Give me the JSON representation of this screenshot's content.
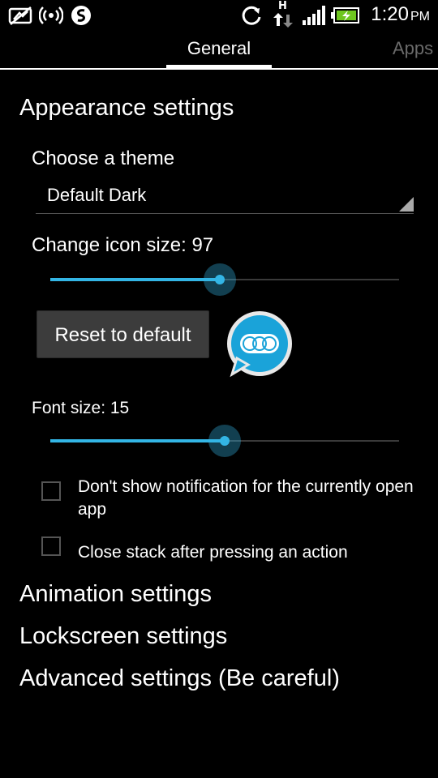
{
  "status_bar": {
    "time": "1:20",
    "ampm": "PM",
    "icons": [
      "no-sim-icon",
      "wireless-icon",
      "swiftkey-icon",
      "sync-icon",
      "data-transfer-icon",
      "signal-icon",
      "battery-charging-icon"
    ],
    "network_type": "H"
  },
  "tabs": [
    {
      "label": "General",
      "selected": true
    },
    {
      "label": "Apps",
      "selected": false
    }
  ],
  "sections": {
    "appearance": "Appearance settings",
    "animation": "Animation settings",
    "lockscreen": "Lockscreen settings",
    "advanced": "Advanced settings (Be careful)"
  },
  "theme": {
    "label": "Choose a theme",
    "value": "Default Dark"
  },
  "icon_size": {
    "label": "Change icon size: 97",
    "value": 97,
    "fraction": 0.485
  },
  "reset_button": "Reset to default",
  "font_size": {
    "label": "Font size: 15",
    "value": 15,
    "fraction": 0.5
  },
  "checkboxes": [
    {
      "label": "Don't show notification for the currently open app",
      "checked": false
    },
    {
      "label": "Close stack after pressing an action",
      "checked": false
    }
  ],
  "colors": {
    "accent": "#33b5e5",
    "background": "#000000"
  }
}
